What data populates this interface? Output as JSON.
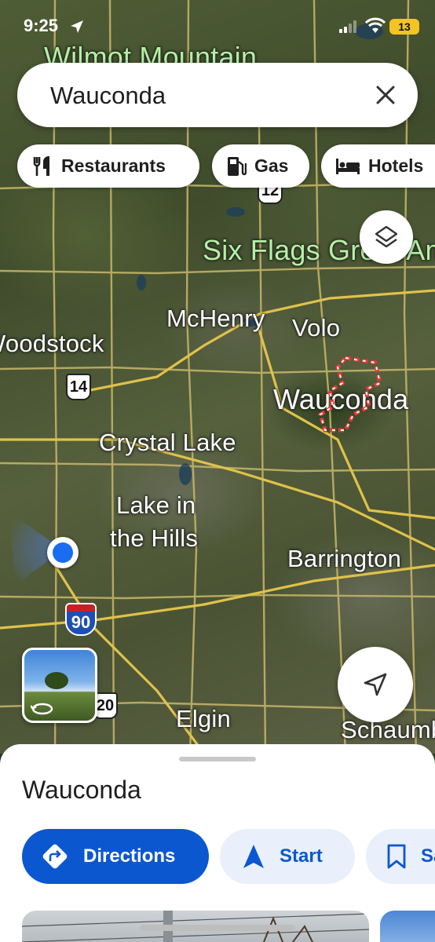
{
  "status_bar": {
    "time": "9:25",
    "battery": "13"
  },
  "search": {
    "query": "Wauconda"
  },
  "chips": [
    {
      "label": "Restaurants",
      "icon": "fork-knife-icon"
    },
    {
      "label": "Gas",
      "icon": "gas-pump-icon"
    },
    {
      "label": "Hotels",
      "icon": "bed-icon"
    }
  ],
  "map": {
    "labels": {
      "wilmot": "Wilmot Mountain",
      "six_flags": "Six Flags Great America",
      "mchenry": "McHenry",
      "volo": "Volo",
      "woodstock": "Woodstock",
      "wauconda": "Wauconda",
      "crystal_lake": "Crystal Lake",
      "lake_hills_1": "Lake in",
      "lake_hills_2": "the Hills",
      "barrington": "Barrington",
      "elgin": "Elgin",
      "schaumburg": "Schaumburg"
    },
    "shields": {
      "us12": "12",
      "us14": "14",
      "i90": "90",
      "us20": "20"
    }
  },
  "sheet": {
    "title": "Wauconda",
    "actions": {
      "directions": "Directions",
      "start": "Start",
      "save": "Save"
    }
  },
  "colors": {
    "accent": "#0b57d0",
    "accent_light": "#e9f0fb",
    "location": "#1a6cf0"
  }
}
